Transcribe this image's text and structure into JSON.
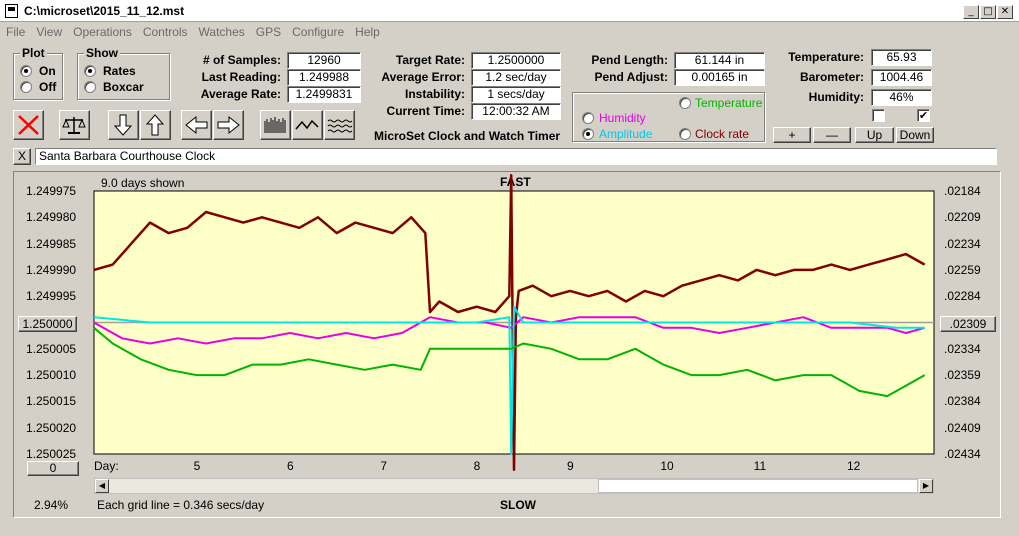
{
  "window": {
    "title": "C:\\microset\\2015_11_12.mst"
  },
  "menu": [
    "File",
    "View",
    "Operations",
    "Controls",
    "Watches",
    "GPS",
    "Configure",
    "Help"
  ],
  "plot_group": {
    "title": "Plot",
    "on": "On",
    "off": "Off",
    "selected": "On"
  },
  "show_group": {
    "title": "Show",
    "rates": "Rates",
    "boxcar": "Boxcar",
    "selected": "Rates"
  },
  "stats": {
    "samples_label": "# of Samples:",
    "samples": "12960",
    "last_label": "Last Reading:",
    "last": "1.249988",
    "avg_label": "Average Rate:",
    "avg": "1.2499831",
    "target_label": "Target Rate:",
    "target": "1.2500000",
    "avgerr_label": "Average Error:",
    "avgerr": "1.2 sec/day",
    "instab_label": "Instability:",
    "instab": "1 secs/day",
    "time_label": "Current Time:",
    "time": "12:00:32 AM",
    "pendlen_label": "Pend Length:",
    "pendlen": "61.144 in",
    "pendadj_label": "Pend Adjust:",
    "pendadj": "0.00165 in",
    "temp_label": "Temperature:",
    "temp": "65.93",
    "baro_label": "Barometer:",
    "baro": "1004.46",
    "hum_label": "Humidity:",
    "hum": "46%"
  },
  "app_caption": "MicroSet Clock and Watch Timer",
  "series_select": {
    "temperature": "Temperature",
    "humidity": "Humidity",
    "amplitude": "Amplitude",
    "clockrate": "Clock rate",
    "selected": "Amplitude"
  },
  "plot_buttons": {
    "plus": "+",
    "minus": "—",
    "up": "Up",
    "down": "Down"
  },
  "checkboxes": {
    "left_checked": false,
    "right_checked": true
  },
  "clock_name": "Santa Barbara Courthouse Clock",
  "clear_label": "X",
  "plot": {
    "days_shown": "9.0 days shown",
    "fast": "FAST",
    "slow": "SLOW",
    "center_left": "1.250000",
    "center_right": ".02309",
    "zero_button": "0",
    "day_label": "Day:",
    "percent": "2.94%",
    "grid_note": "Each grid line = 0.346 secs/day"
  },
  "colors": {
    "plot_bg": "#ffffc8",
    "clock_rate": "#800000",
    "humidity": "#e600e6",
    "amplitude": "#00e6e6",
    "temperature": "#00b400",
    "reset_x": "#ff0000"
  },
  "chart_data": {
    "type": "line",
    "xlabel": "Day:",
    "x_ticks": [
      5,
      6,
      7,
      8,
      9,
      10,
      11,
      12
    ],
    "xlim": [
      3.9,
      12.9
    ],
    "y_left_ticks": [
      "1.249975",
      "1.249980",
      "1.249985",
      "1.249990",
      "1.249995",
      "1.250000",
      "1.250005",
      "1.250010",
      "1.250015",
      "1.250020",
      "1.250025"
    ],
    "y_right_ticks": [
      ".02184",
      ".02209",
      ".02234",
      ".02259",
      ".02284",
      ".02309",
      ".02334",
      ".02359",
      ".02384",
      ".02409",
      ".02434"
    ],
    "ylim_left": [
      1.249975,
      1.250025
    ],
    "grid": true,
    "series": [
      {
        "name": "Clock rate",
        "color": "#800000",
        "x": [
          3.9,
          4.1,
          4.3,
          4.5,
          4.7,
          4.9,
          5.1,
          5.3,
          5.5,
          5.7,
          5.9,
          6.1,
          6.3,
          6.5,
          6.7,
          6.9,
          7.1,
          7.3,
          7.45,
          7.5,
          7.6,
          7.8,
          8.0,
          8.2,
          8.35,
          8.37,
          8.4,
          8.42,
          8.45,
          8.6,
          8.8,
          9.0,
          9.2,
          9.4,
          9.6,
          9.8,
          10.0,
          10.2,
          10.4,
          10.6,
          10.8,
          11.0,
          11.2,
          11.4,
          11.6,
          11.8,
          12.0,
          12.2,
          12.4,
          12.6,
          12.8
        ],
        "y": [
          1.24999,
          1.249989,
          1.249985,
          1.249981,
          1.249983,
          1.249982,
          1.249979,
          1.24998,
          1.249981,
          1.24998,
          1.249981,
          1.249982,
          1.24998,
          1.249983,
          1.249981,
          1.249982,
          1.249983,
          1.24998,
          1.249983,
          1.249998,
          1.249996,
          1.249998,
          1.249997,
          1.249998,
          1.249995,
          1.249972,
          1.250028,
          1.249999,
          1.249994,
          1.249993,
          1.249995,
          1.249994,
          1.249995,
          1.249994,
          1.249996,
          1.249994,
          1.249995,
          1.249993,
          1.249992,
          1.249991,
          1.249992,
          1.24999,
          1.249991,
          1.24999,
          1.24999,
          1.249989,
          1.24999,
          1.249989,
          1.249988,
          1.249987,
          1.249989
        ]
      },
      {
        "name": "Humidity",
        "color": "#e600e6",
        "x": [
          3.9,
          4.2,
          4.5,
          4.8,
          5.1,
          5.4,
          5.7,
          6.0,
          6.3,
          6.6,
          6.9,
          7.2,
          7.5,
          7.8,
          8.1,
          8.37,
          8.5,
          8.8,
          9.1,
          9.4,
          9.7,
          10.0,
          10.3,
          10.6,
          10.9,
          11.2,
          11.5,
          11.8,
          12.1,
          12.4,
          12.6,
          12.8
        ],
        "y": [
          1.25,
          1.250003,
          1.250004,
          1.250003,
          1.250004,
          1.250003,
          1.250003,
          1.250002,
          1.250003,
          1.250002,
          1.250003,
          1.250002,
          1.249999,
          1.25,
          1.25,
          1.250001,
          1.249999,
          1.25,
          1.249999,
          1.249999,
          1.249999,
          1.250001,
          1.250001,
          1.250002,
          1.250001,
          1.25,
          1.249999,
          1.250001,
          1.250001,
          1.250001,
          1.250002,
          1.250001
        ]
      },
      {
        "name": "Amplitude",
        "color": "#00e6e6",
        "x": [
          3.9,
          4.5,
          5.0,
          5.5,
          6.0,
          6.5,
          7.0,
          7.5,
          8.0,
          8.35,
          8.37,
          8.4,
          8.5,
          9.0,
          9.5,
          10.0,
          10.5,
          11.0,
          11.5,
          12.0,
          12.5,
          12.8
        ],
        "y": [
          1.249999,
          1.25,
          1.25,
          1.25,
          1.25,
          1.25,
          1.25,
          1.25,
          1.25,
          1.249999,
          1.250025,
          1.249997,
          1.25,
          1.25,
          1.25,
          1.25,
          1.25,
          1.25,
          1.25,
          1.25,
          1.250001,
          1.250001
        ]
      },
      {
        "name": "Temperature",
        "color": "#00b400",
        "x": [
          3.9,
          4.1,
          4.4,
          4.7,
          5.0,
          5.3,
          5.6,
          5.9,
          6.2,
          6.5,
          6.8,
          7.1,
          7.4,
          7.5,
          7.8,
          8.1,
          8.37,
          8.5,
          8.8,
          9.1,
          9.4,
          9.7,
          10.0,
          10.3,
          10.6,
          10.9,
          11.2,
          11.5,
          11.8,
          12.1,
          12.4,
          12.6,
          12.8
        ],
        "y": [
          1.250001,
          1.250004,
          1.250007,
          1.250009,
          1.25001,
          1.25001,
          1.250008,
          1.250008,
          1.250007,
          1.250008,
          1.250009,
          1.250008,
          1.250009,
          1.250005,
          1.250005,
          1.250005,
          1.250005,
          1.250004,
          1.250005,
          1.250007,
          1.250007,
          1.250005,
          1.250008,
          1.25001,
          1.25001,
          1.250009,
          1.250011,
          1.25001,
          1.25001,
          1.250013,
          1.250014,
          1.250012,
          1.25001
        ]
      }
    ]
  }
}
